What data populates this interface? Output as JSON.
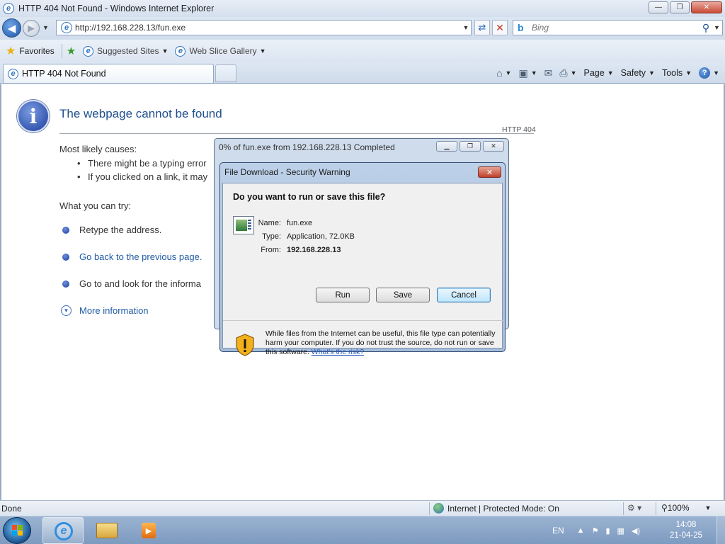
{
  "window": {
    "title": "HTTP 404 Not Found - Windows Internet Explorer",
    "controls": {
      "minimize": "—",
      "maximize": "❐",
      "close": "✕"
    }
  },
  "navigation": {
    "address": "http://192.168.228.13/fun.exe",
    "search_placeholder": "Bing"
  },
  "favorites_bar": {
    "favorites_label": "Favorites",
    "links": [
      {
        "label": "Suggested Sites"
      },
      {
        "label": "Web Slice Gallery"
      }
    ]
  },
  "tabs": {
    "active_label": "HTTP 404 Not Found"
  },
  "command_bar": {
    "page_label": "Page",
    "safety_label": "Safety",
    "tools_label": "Tools"
  },
  "page": {
    "title": "The webpage cannot be found",
    "http_code": "HTTP 404",
    "causes_heading": "Most likely causes:",
    "causes": [
      "There might be a typing error",
      "If you clicked on a link, it may"
    ],
    "try_heading": "What you can try:",
    "try_items": [
      "Retype the address.",
      "Go back to the previous page.",
      "Go to  and look for the informa"
    ],
    "more_info": "More information"
  },
  "download_progress": {
    "title": "0% of fun.exe from 192.168.228.13 Completed"
  },
  "security_dialog": {
    "title": "File Download - Security Warning",
    "question": "Do you want to run or save this file?",
    "name_label": "Name:",
    "name_value": "fun.exe",
    "type_label": "Type:",
    "type_value": "Application, 72.0KB",
    "from_label": "From:",
    "from_value": "192.168.228.13",
    "run_label": "Run",
    "save_label": "Save",
    "cancel_label": "Cancel",
    "warning_text": "While files from the Internet can be useful, this file type can potentially harm your computer. If you do not trust the source, do not run or save this software.",
    "risk_link": "What's the risk?"
  },
  "status_bar": {
    "status": "Done",
    "zone": "Internet | Protected Mode: On",
    "zoom": "100%"
  },
  "taskbar": {
    "language": "EN",
    "time": "14:08",
    "date": "21-04-25"
  }
}
